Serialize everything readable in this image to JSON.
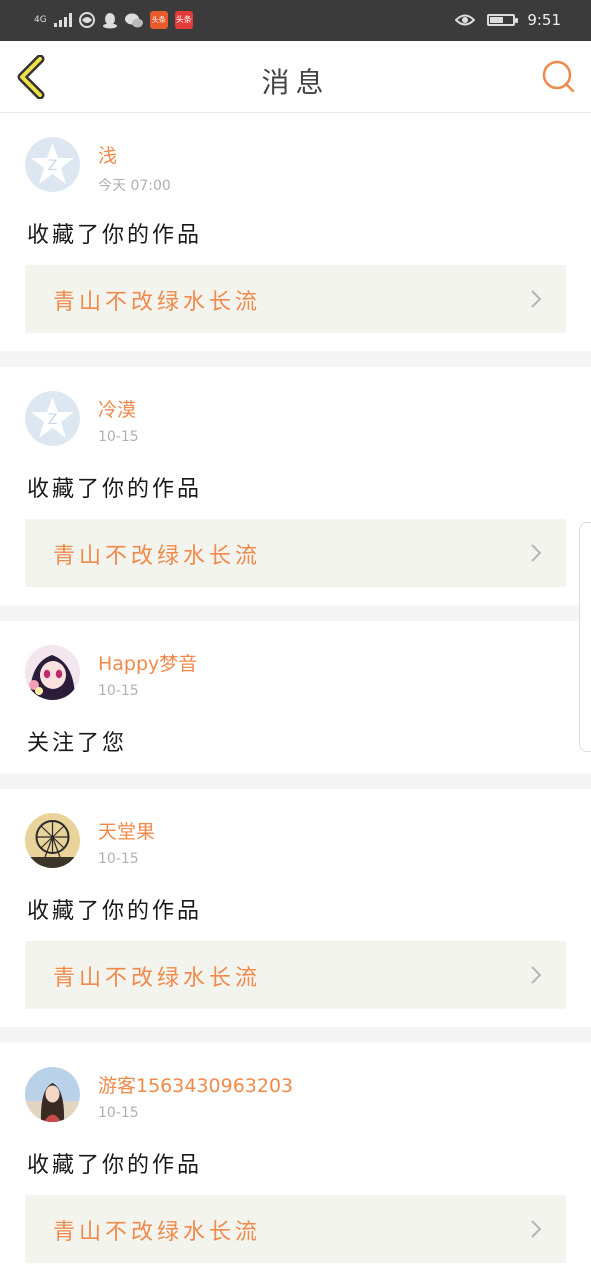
{
  "status_bar": {
    "network": "4G",
    "app_badges": [
      {
        "icon": "news-app-icon",
        "label": "头条"
      },
      {
        "icon": "game-app-icon",
        "label": "头条"
      }
    ],
    "time": "9:51",
    "battery_level": 0.54
  },
  "header": {
    "title": "消息"
  },
  "messages": [
    {
      "username": "浅",
      "time": "今天 07:00",
      "text": "收藏了你的作品",
      "work_title": "青山不改绿水长流",
      "avatar": "default-avatar-icon"
    },
    {
      "username": "冷漠",
      "time": "10-15",
      "text": "收藏了你的作品",
      "work_title": "青山不改绿水长流",
      "avatar": "default-avatar-icon"
    },
    {
      "username": "Happy梦音",
      "time": "10-15",
      "text": "关注了您",
      "work_title": null,
      "avatar": "anime-girl-avatar"
    },
    {
      "username": "天堂果",
      "time": "10-15",
      "text": "收藏了你的作品",
      "work_title": "青山不改绿水长流",
      "avatar": "ferris-wheel-avatar"
    },
    {
      "username": "游客1563430963203",
      "time": "10-15",
      "text": "收藏了你的作品",
      "work_title": "青山不改绿水长流",
      "avatar": "girl-photo-avatar"
    }
  ]
}
